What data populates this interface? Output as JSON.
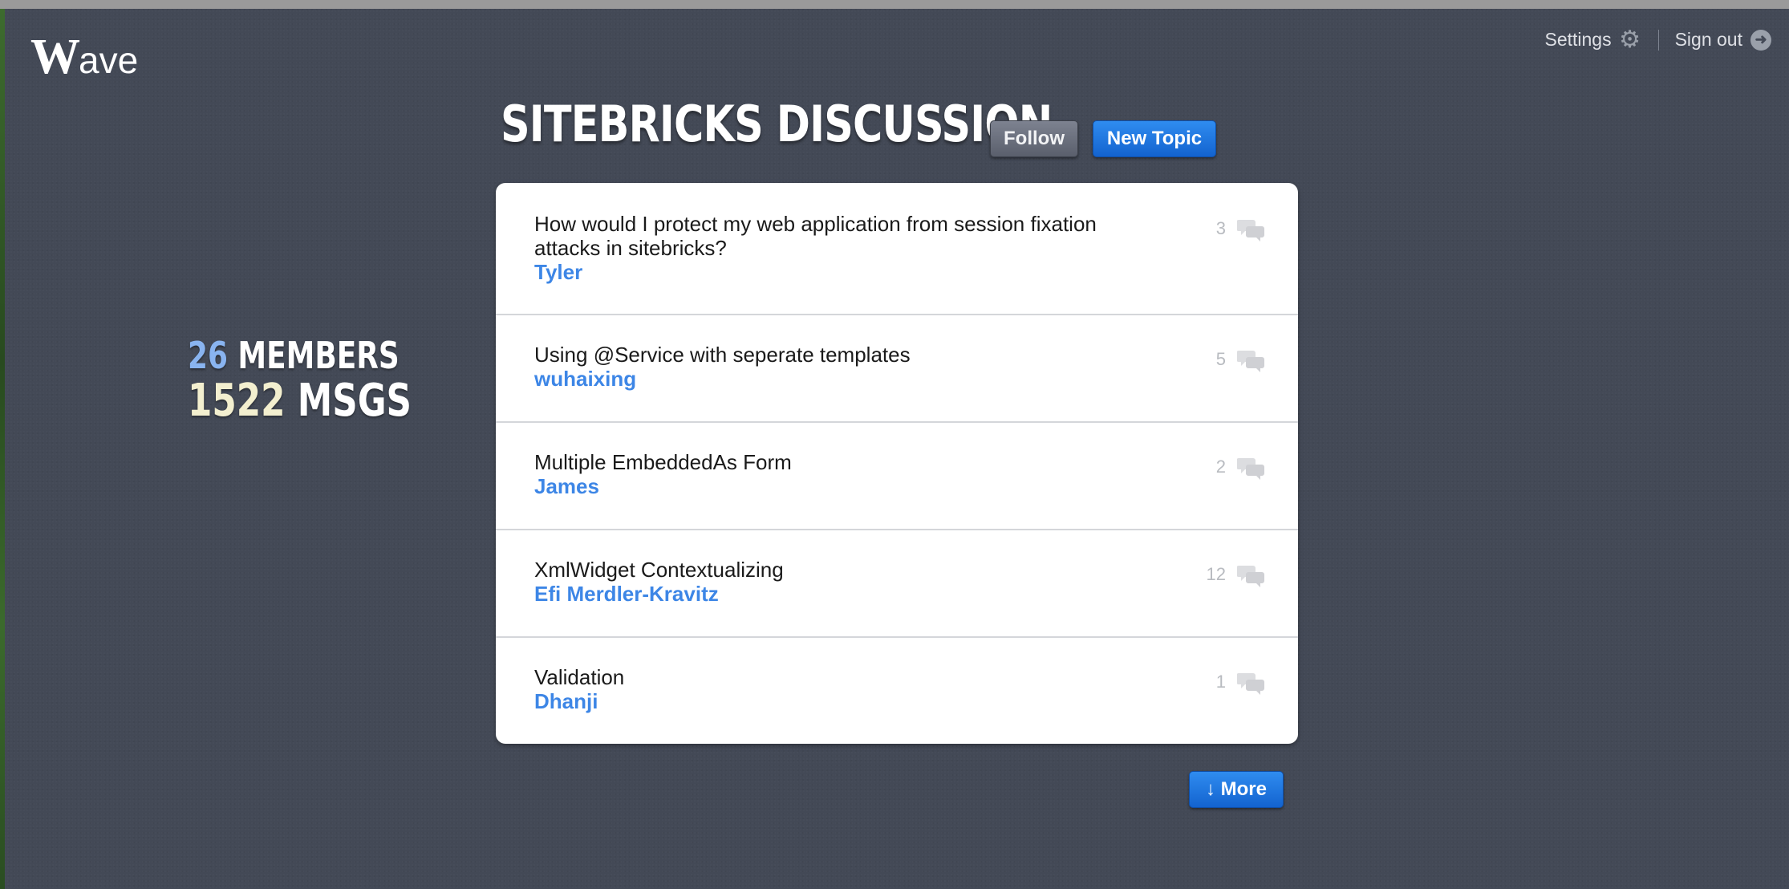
{
  "app": {
    "logo_initial": "W",
    "logo_rest": "ave"
  },
  "header": {
    "settings_label": "Settings",
    "signout_label": "Sign out"
  },
  "group": {
    "title": "SITEBRICKS DISCUSSION",
    "follow_label": "Follow",
    "new_topic_label": "New Topic"
  },
  "stats": {
    "members_count": "26",
    "members_label": "MEMBERS",
    "msgs_count": "1522",
    "msgs_label": "MSGS"
  },
  "topics": [
    {
      "title": "How would I protect my web application from session fixation attacks in sitebricks?",
      "author": "Tyler",
      "replies": "3"
    },
    {
      "title": "Using @Service with seperate templates",
      "author": "wuhaixing",
      "replies": "5"
    },
    {
      "title": "Multiple EmbeddedAs Form",
      "author": "James",
      "replies": "2"
    },
    {
      "title": "XmlWidget Contextualizing",
      "author": "Efi Merdler-Kravitz",
      "replies": "12"
    },
    {
      "title": "Validation",
      "author": "Dhanji",
      "replies": "1"
    }
  ],
  "more_label": "↓ More",
  "icons": {
    "settings": "gear-icon",
    "signout": "arrow-right-circle-icon",
    "replies": "speech-bubbles-icon"
  },
  "colors": {
    "background": "#434956",
    "accent": "#1e78e6",
    "author_link": "#3d86e6",
    "members_number": "#89b4f0",
    "msgs_number": "#f3efcf"
  }
}
